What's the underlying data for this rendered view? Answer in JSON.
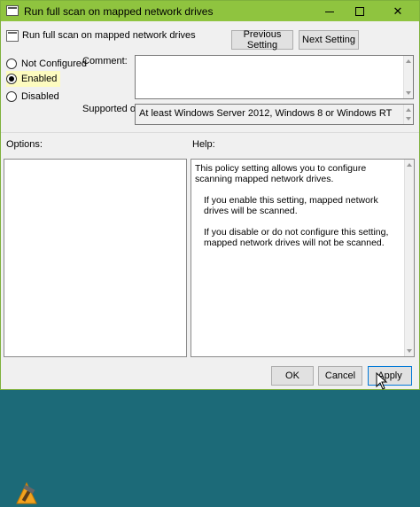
{
  "window": {
    "title": "Run full scan on mapped network drives",
    "minimize_glyph": "",
    "maximize_glyph": "",
    "close_glyph": "✕"
  },
  "header": {
    "setting_name": "Run full scan on mapped network drives",
    "previous_label": "Previous Setting",
    "next_label": "Next Setting"
  },
  "state": {
    "options": [
      {
        "label": "Not Configured",
        "selected": false
      },
      {
        "label": "Enabled",
        "selected": true
      },
      {
        "label": "Disabled",
        "selected": false
      }
    ]
  },
  "comment": {
    "label": "Comment:",
    "value": ""
  },
  "supported": {
    "label": "Supported on:",
    "value": "At least Windows Server 2012, Windows 8 or Windows RT"
  },
  "panes": {
    "options_label": "Options:",
    "help_label": "Help:",
    "help_paragraphs": [
      "This policy setting allows you to configure scanning mapped network drives.",
      "If you enable this setting, mapped network drives will be scanned.",
      "If you disable or do not configure this setting, mapped network drives will not be scanned."
    ]
  },
  "footer": {
    "ok_label": "OK",
    "cancel_label": "Cancel",
    "apply_label": "Apply"
  },
  "colors": {
    "titlebar": "#8fc43f",
    "accent": "#0078d7",
    "selected_bg": "#fdfbc0"
  },
  "icons": {
    "title_icon": "policy-setting-icon",
    "header_icon": "policy-setting-icon",
    "logo": "hammer-logo-icon",
    "cursor": "mouse-pointer-icon"
  }
}
